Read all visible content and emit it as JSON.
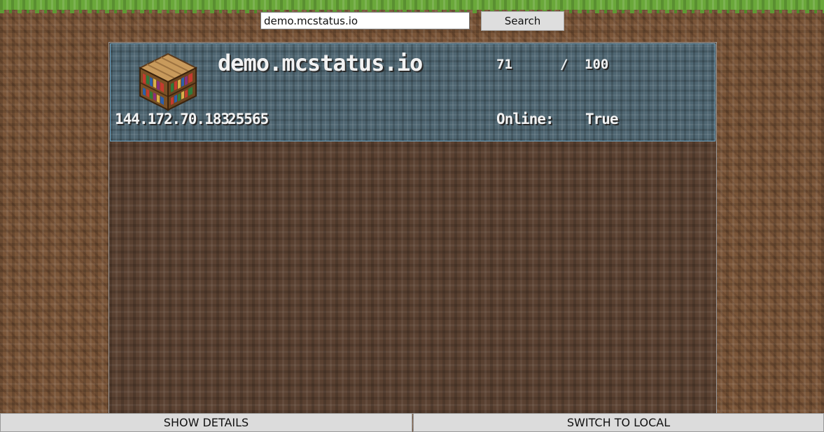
{
  "search": {
    "value": "demo.mcstatus.io",
    "button_label": "Search"
  },
  "server": {
    "hostname": "demo.mcstatus.io",
    "players_online": "71",
    "players_separator": "/",
    "players_max": "100",
    "ip": "144.172.70.183",
    "port": "25565",
    "online_label": "Online:",
    "online_value": "True",
    "icon": "bookshelf-icon"
  },
  "footer": {
    "show_details_label": "SHOW DETAILS",
    "switch_local_label": "SWITCH TO LOCAL"
  },
  "colors": {
    "grass": "#6aa83a",
    "dirt": "#7a5538",
    "card": "#4f6672",
    "card_border": "#6fa7c7",
    "button": "#dcdcdc"
  }
}
